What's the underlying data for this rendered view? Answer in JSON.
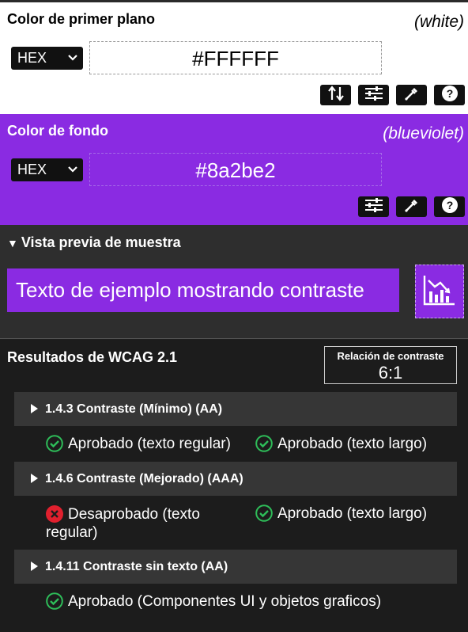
{
  "foreground": {
    "title": "Color de primer plano",
    "color_name": "(white)",
    "format": "HEX",
    "value": "#FFFFFF",
    "icons": [
      "swap-icon",
      "sliders-icon",
      "eyedropper-icon",
      "help-icon"
    ]
  },
  "background": {
    "title": "Color de fondo",
    "color_name": "(blueviolet)",
    "format": "HEX",
    "value": "#8a2be2",
    "icons": [
      "sliders-icon",
      "eyedropper-icon",
      "help-icon"
    ]
  },
  "preview": {
    "title": "Vista previa de muestra",
    "sample_text": "Texto de ejemplo mostrando contraste"
  },
  "wcag": {
    "title": "Resultados de WCAG 2.1",
    "ratio_label": "Relación de contraste",
    "ratio_value": "6:1",
    "criteria": [
      {
        "label": "1.4.3 Contraste (Mínimo) (AA)",
        "results": [
          {
            "status": "pass",
            "text": "Aprobado (texto regular)"
          },
          {
            "status": "pass",
            "text": "Aprobado (texto largo)"
          }
        ]
      },
      {
        "label": "1.4.6 Contraste (Mejorado) (AAA)",
        "results": [
          {
            "status": "fail",
            "text": "Desaprobado (texto regular)"
          },
          {
            "status": "pass",
            "text": "Aprobado (texto largo)"
          }
        ]
      },
      {
        "label": "1.4.11 Contraste sin texto (AA)",
        "results": [
          {
            "status": "pass",
            "text": "Aprobado (Componentes UI y objetos graficos)"
          }
        ]
      }
    ]
  },
  "colors": {
    "accent": "#8a2be2",
    "pass": "#2ebd59",
    "fail": "#e0202e"
  }
}
